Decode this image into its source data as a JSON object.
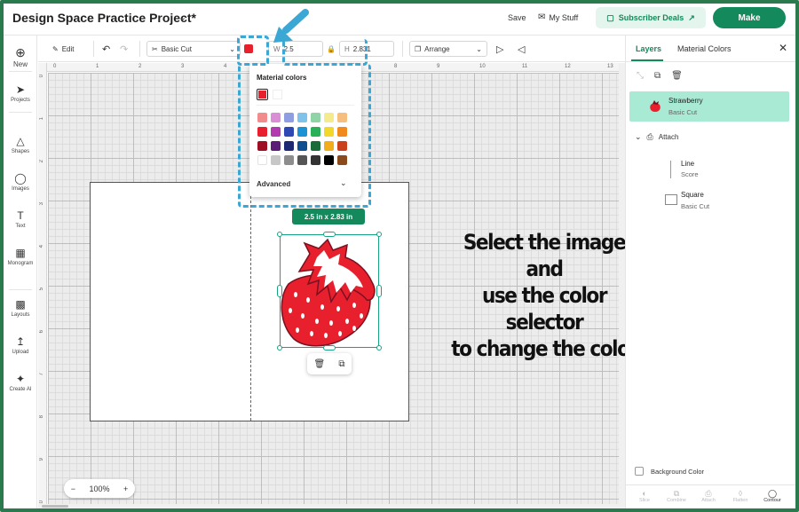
{
  "header": {
    "project_title": "Design Space Practice Project*",
    "save": "Save",
    "my_stuff": "My Stuff",
    "subscriber_deals": "Subscriber Deals",
    "make": "Make"
  },
  "left_nav": {
    "new": "New",
    "items": [
      "Projects",
      "Shapes",
      "Images",
      "Text",
      "Monogram",
      "Layouts",
      "Upload",
      "Create AI"
    ]
  },
  "toolbar": {
    "edit": "Edit",
    "operation": "Basic Cut",
    "width_label": "W",
    "width_value": "2.5",
    "height_label": "H",
    "height_value": "2.831",
    "arrange": "Arrange"
  },
  "ruler": {
    "top": [
      "0",
      "1",
      "2",
      "3",
      "4",
      "5",
      "6",
      "7",
      "8",
      "9",
      "10",
      "11",
      "12",
      "13"
    ],
    "left": [
      "0",
      "1",
      "2",
      "3",
      "4",
      "5",
      "6",
      "7",
      "8",
      "9",
      "10"
    ]
  },
  "color_popover": {
    "title": "Material colors",
    "current_color": "#e8202e",
    "palette": [
      "#f28b8b",
      "#d98ed6",
      "#8e9ee0",
      "#7fc3ea",
      "#8fd3a6",
      "#f4ec8c",
      "#f6bf7f",
      "#e8202e",
      "#b23bb0",
      "#2f49b4",
      "#1d93d6",
      "#2bb05a",
      "#f2d82a",
      "#f28a1b",
      "#9e0f25",
      "#5b1d78",
      "#1d2a73",
      "#0f4f8f",
      "#1b6b3a",
      "#f2ad1b",
      "#c9401a",
      "#ffffff",
      "#c7c7c7",
      "#8d8d8d",
      "#555555",
      "#333333",
      "#000000",
      "#8b4a1c"
    ],
    "advanced": "Advanced"
  },
  "canvas": {
    "size_badge": "2.5  in x 2.83  in",
    "zoom": "100%"
  },
  "instruction": {
    "lines": [
      "Select the image and",
      "use the color selector",
      "to change the color"
    ]
  },
  "right_panel": {
    "tab_layers": "Layers",
    "tab_material_colors": "Material Colors",
    "layer1_name": "Strawberry",
    "layer1_op": "Basic Cut",
    "group_name": "Attach",
    "layer2_name": "Line",
    "layer2_op": "Score",
    "layer3_name": "Square",
    "layer3_op": "Basic Cut",
    "background_color": "Background Color",
    "bottom_actions": [
      "Slice",
      "Combine",
      "Attach",
      "Flatten",
      "Contour"
    ]
  },
  "colors": {
    "brand_green": "#14895b",
    "highlight_blue": "#3aa7d4",
    "selected_layer_bg": "#a8ead3"
  }
}
